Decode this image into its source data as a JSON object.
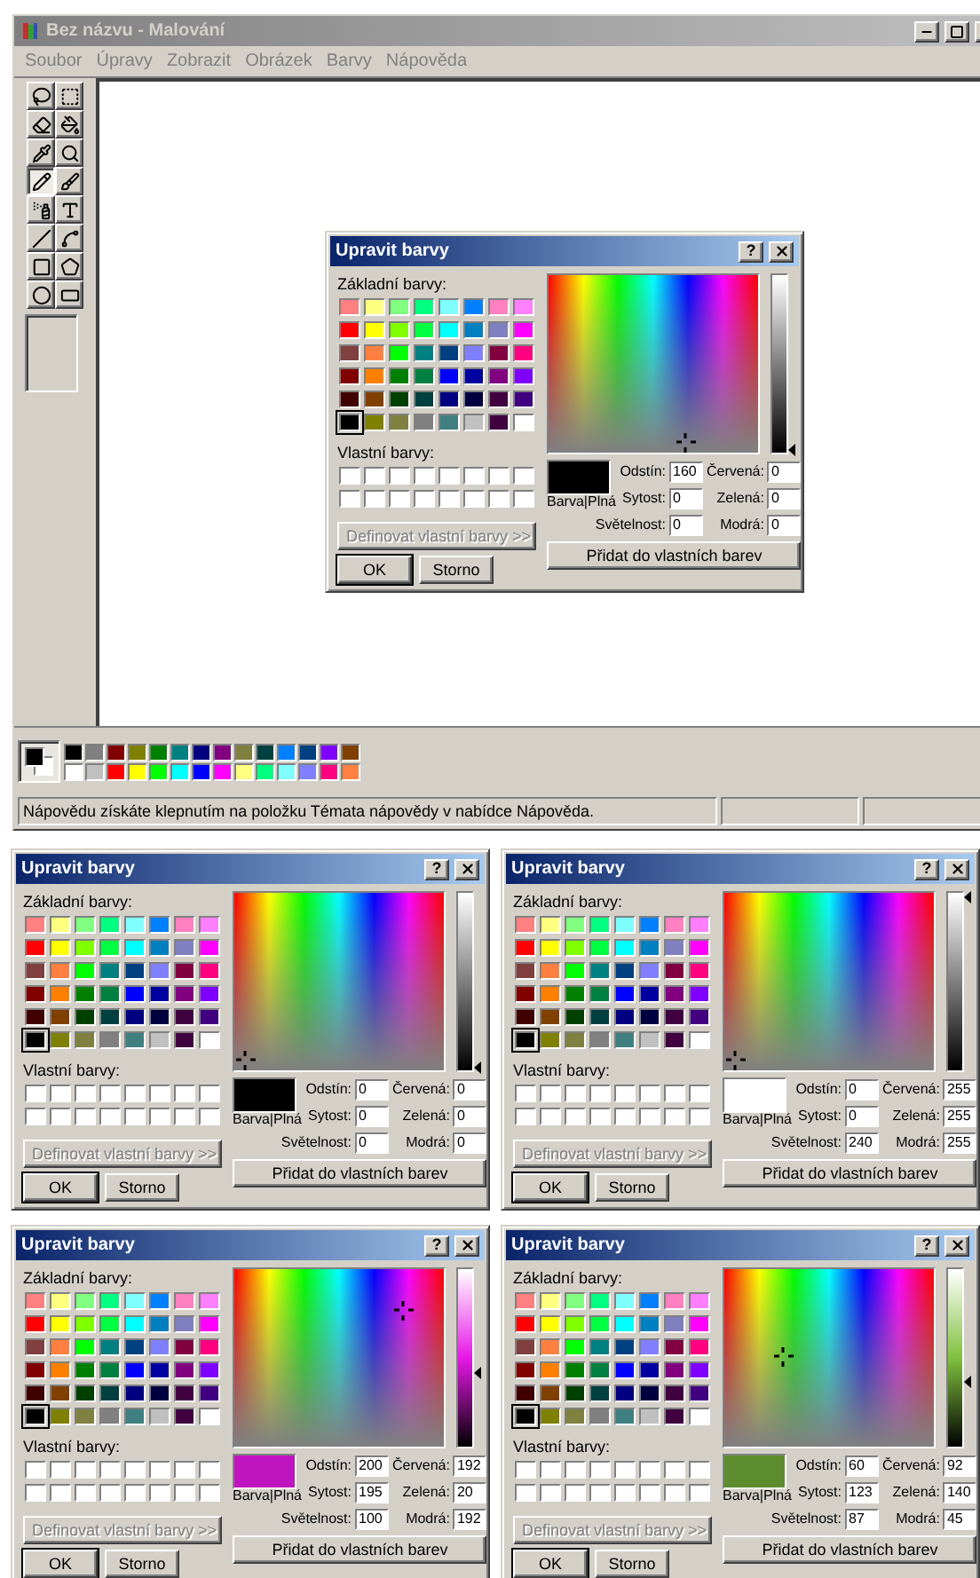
{
  "basic_colors": [
    {
      "color": "#ff8080",
      "selected": false
    },
    {
      "color": "#ffff80",
      "selected": false
    },
    {
      "color": "#80ff80",
      "selected": false
    },
    {
      "color": "#00ff80",
      "selected": false
    },
    {
      "color": "#80ffff",
      "selected": false
    },
    {
      "color": "#0080ff",
      "selected": false
    },
    {
      "color": "#ff80c0",
      "selected": false
    },
    {
      "color": "#ff80ff",
      "selected": false
    },
    {
      "color": "#ff0000",
      "selected": false
    },
    {
      "color": "#ffff00",
      "selected": false
    },
    {
      "color": "#80ff00",
      "selected": false
    },
    {
      "color": "#00ff40",
      "selected": false
    },
    {
      "color": "#00ffff",
      "selected": false
    },
    {
      "color": "#0080c0",
      "selected": false
    },
    {
      "color": "#8080c0",
      "selected": false
    },
    {
      "color": "#ff00ff",
      "selected": false
    },
    {
      "color": "#804040",
      "selected": false
    },
    {
      "color": "#ff8040",
      "selected": false
    },
    {
      "color": "#00ff00",
      "selected": false
    },
    {
      "color": "#008080",
      "selected": false
    },
    {
      "color": "#004080",
      "selected": false
    },
    {
      "color": "#8080ff",
      "selected": false
    },
    {
      "color": "#800040",
      "selected": false
    },
    {
      "color": "#ff0080",
      "selected": false
    },
    {
      "color": "#800000",
      "selected": false
    },
    {
      "color": "#ff8000",
      "selected": false
    },
    {
      "color": "#008000",
      "selected": false
    },
    {
      "color": "#008040",
      "selected": false
    },
    {
      "color": "#0000ff",
      "selected": false
    },
    {
      "color": "#0000a0",
      "selected": false
    },
    {
      "color": "#800080",
      "selected": false
    },
    {
      "color": "#8000ff",
      "selected": false
    },
    {
      "color": "#400000",
      "selected": false
    },
    {
      "color": "#804000",
      "selected": false
    },
    {
      "color": "#004000",
      "selected": false
    },
    {
      "color": "#004040",
      "selected": false
    },
    {
      "color": "#000080",
      "selected": false
    },
    {
      "color": "#000040",
      "selected": false
    },
    {
      "color": "#400040",
      "selected": false
    },
    {
      "color": "#400080",
      "selected": false
    },
    {
      "color": "#000000",
      "selected": true
    },
    {
      "color": "#808000",
      "selected": false
    },
    {
      "color": "#808040",
      "selected": false
    },
    {
      "color": "#808080",
      "selected": false
    },
    {
      "color": "#408080",
      "selected": false
    },
    {
      "color": "#c0c0c0",
      "selected": false
    },
    {
      "color": "#400040",
      "selected": false
    },
    {
      "color": "#ffffff",
      "selected": false
    }
  ],
  "paint_window": {
    "title": "Bez názvu - Malování",
    "active": false,
    "menu": [
      {
        "label": "Soubor",
        "disabled": true
      },
      {
        "label": "Úpravy",
        "disabled": true
      },
      {
        "label": "Zobrazit",
        "disabled": true
      },
      {
        "label": "Obrázek",
        "disabled": true
      },
      {
        "label": "Barvy",
        "disabled": true
      },
      {
        "label": "Nápověda",
        "disabled": true
      }
    ],
    "tools": [
      {
        "kind": "free-select",
        "selected": false
      },
      {
        "kind": "rect-select",
        "selected": false
      },
      {
        "kind": "eraser",
        "selected": false
      },
      {
        "kind": "fill",
        "selected": false
      },
      {
        "kind": "picker",
        "selected": false
      },
      {
        "kind": "magnifier",
        "selected": false
      },
      {
        "kind": "pencil",
        "selected": true
      },
      {
        "kind": "brush",
        "selected": false
      },
      {
        "kind": "airbrush",
        "selected": false
      },
      {
        "kind": "text",
        "selected": false
      },
      {
        "kind": "line",
        "selected": false
      },
      {
        "kind": "curve",
        "selected": false
      },
      {
        "kind": "rectangle",
        "selected": false
      },
      {
        "kind": "polygon",
        "selected": false
      },
      {
        "kind": "ellipse",
        "selected": false
      },
      {
        "kind": "rounded-rectangle",
        "selected": false
      }
    ],
    "current_colors": [
      {
        "kind": "foreground",
        "color": "#000000"
      },
      {
        "kind": "background",
        "color": "#ffffff"
      }
    ],
    "palette": [
      {
        "color": "#000000"
      },
      {
        "color": "#808080"
      },
      {
        "color": "#800000"
      },
      {
        "color": "#808000"
      },
      {
        "color": "#008000"
      },
      {
        "color": "#008080"
      },
      {
        "color": "#000080"
      },
      {
        "color": "#800080"
      },
      {
        "color": "#808040"
      },
      {
        "color": "#004040"
      },
      {
        "color": "#0080ff"
      },
      {
        "color": "#004080"
      },
      {
        "color": "#8000ff"
      },
      {
        "color": "#804000"
      },
      {
        "color": "#ffffff"
      },
      {
        "color": "#c0c0c0"
      },
      {
        "color": "#ff0000"
      },
      {
        "color": "#ffff00"
      },
      {
        "color": "#00ff00"
      },
      {
        "color": "#00ffff"
      },
      {
        "color": "#0000ff"
      },
      {
        "color": "#ff00ff"
      },
      {
        "color": "#ffff80"
      },
      {
        "color": "#00ff80"
      },
      {
        "color": "#80ffff"
      },
      {
        "color": "#8080ff"
      },
      {
        "color": "#ff0080"
      },
      {
        "color": "#ff8040"
      }
    ],
    "status_bar": "Nápovědu získáte klepnutím na položku Témata nápovědy v nabídce Nápověda."
  },
  "dialogs": [
    {
      "title": "Upravit barvy",
      "active": true,
      "help": "?",
      "basic_label": "Základní barvy:",
      "custom_label": "Vlastní barvy:",
      "define_button": {
        "label": "Definovat vlastní barvy >>",
        "disabled": true
      },
      "ok": "OK",
      "cancel": "Storno",
      "preview": {
        "color": "#000000"
      },
      "preview_label": "Barva|Plná",
      "add_button": "Přidat do vlastních barev",
      "fields": [
        {
          "kind": "hue",
          "label": "Odstín:",
          "value": "160"
        },
        {
          "kind": "red",
          "label": "Červená:",
          "value": "0"
        },
        {
          "kind": "sat",
          "label": "Sytost:",
          "value": "0"
        },
        {
          "kind": "green",
          "label": "Zelená:",
          "value": "0"
        },
        {
          "kind": "lum",
          "label": "Světelnost:",
          "value": "0"
        },
        {
          "kind": "blue",
          "label": "Modrá:",
          "value": "0"
        }
      ]
    },
    {
      "title": "Upravit barvy",
      "active": true,
      "help": "?",
      "basic_label": "Základní barvy:",
      "custom_label": "Vlastní barvy:",
      "define_button": {
        "label": "Definovat vlastní barvy >>",
        "disabled": true
      },
      "ok": "OK",
      "cancel": "Storno",
      "preview": {
        "color": "#000000"
      },
      "preview_label": "Barva|Plná",
      "add_button": "Přidat do vlastních barev",
      "fields": [
        {
          "kind": "hue",
          "label": "Odstín:",
          "value": "0"
        },
        {
          "kind": "red",
          "label": "Červená:",
          "value": "0"
        },
        {
          "kind": "sat",
          "label": "Sytost:",
          "value": "0"
        },
        {
          "kind": "green",
          "label": "Zelená:",
          "value": "0"
        },
        {
          "kind": "lum",
          "label": "Světelnost:",
          "value": "0"
        },
        {
          "kind": "blue",
          "label": "Modrá:",
          "value": "0"
        }
      ]
    },
    {
      "title": "Upravit barvy",
      "active": true,
      "help": "?",
      "basic_label": "Základní barvy:",
      "custom_label": "Vlastní barvy:",
      "define_button": {
        "label": "Definovat vlastní barvy >>",
        "disabled": true
      },
      "ok": "OK",
      "cancel": "Storno",
      "preview": {
        "color": "#ffffff"
      },
      "preview_label": "Barva|Plná",
      "add_button": "Přidat do vlastních barev",
      "fields": [
        {
          "kind": "hue",
          "label": "Odstín:",
          "value": "0"
        },
        {
          "kind": "red",
          "label": "Červená:",
          "value": "255"
        },
        {
          "kind": "sat",
          "label": "Sytost:",
          "value": "0"
        },
        {
          "kind": "green",
          "label": "Zelená:",
          "value": "255"
        },
        {
          "kind": "lum",
          "label": "Světelnost:",
          "value": "240"
        },
        {
          "kind": "blue",
          "label": "Modrá:",
          "value": "255"
        }
      ]
    },
    {
      "title": "Upravit barvy",
      "active": true,
      "help": "?",
      "basic_label": "Základní barvy:",
      "custom_label": "Vlastní barvy:",
      "define_button": {
        "label": "Definovat vlastní barvy >>",
        "disabled": true
      },
      "ok": "OK",
      "cancel": "Storno",
      "preview": {
        "color": "#c014c0"
      },
      "preview_label": "Barva|Plná",
      "add_button": "Přidat do vlastních barev",
      "fields": [
        {
          "kind": "hue",
          "label": "Odstín:",
          "value": "200"
        },
        {
          "kind": "red",
          "label": "Červená:",
          "value": "192"
        },
        {
          "kind": "sat",
          "label": "Sytost:",
          "value": "195"
        },
        {
          "kind": "green",
          "label": "Zelená:",
          "value": "20"
        },
        {
          "kind": "lum",
          "label": "Světelnost:",
          "value": "100"
        },
        {
          "kind": "blue",
          "label": "Modrá:",
          "value": "192"
        }
      ]
    },
    {
      "title": "Upravit barvy",
      "active": true,
      "help": "?",
      "basic_label": "Základní barvy:",
      "custom_label": "Vlastní barvy:",
      "define_button": {
        "label": "Definovat vlastní barvy >>",
        "disabled": true
      },
      "ok": "OK",
      "cancel": "Storno",
      "preview": {
        "color": "#5c8c2d"
      },
      "preview_label": "Barva|Plná",
      "add_button": "Přidat do vlastních barev",
      "fields": [
        {
          "kind": "hue",
          "label": "Odstín:",
          "value": "60"
        },
        {
          "kind": "red",
          "label": "Červená:",
          "value": "92"
        },
        {
          "kind": "sat",
          "label": "Sytost:",
          "value": "123"
        },
        {
          "kind": "green",
          "label": "Zelená:",
          "value": "140"
        },
        {
          "kind": "lum",
          "label": "Světelnost:",
          "value": "87"
        },
        {
          "kind": "blue",
          "label": "Modrá:",
          "value": "45"
        }
      ]
    }
  ]
}
